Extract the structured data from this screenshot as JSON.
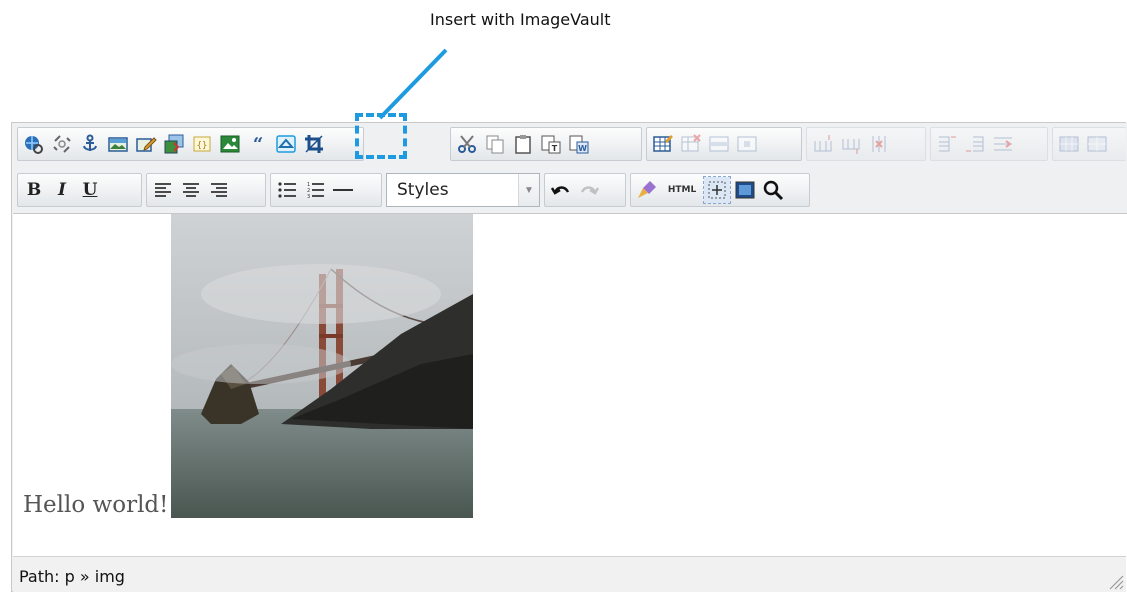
{
  "callout": {
    "text": "Insert with ImageVault",
    "color": "#1e9be0"
  },
  "toolbar": {
    "row1": [
      {
        "name": "insert-link-icon"
      },
      {
        "name": "unlink-icon"
      },
      {
        "name": "anchor-icon"
      },
      {
        "name": "image-icon"
      },
      {
        "name": "edit-image-icon"
      },
      {
        "name": "insert-media-icon"
      },
      {
        "name": "dynamic-content-icon"
      },
      {
        "name": "image-gallery-icon"
      },
      {
        "name": "blockquote-icon"
      },
      {
        "name": "imagevault-insert-icon"
      },
      {
        "name": "crop-icon"
      },
      {
        "name": "cut-icon"
      },
      {
        "name": "copy-icon"
      },
      {
        "name": "paste-icon"
      },
      {
        "name": "paste-text-icon"
      },
      {
        "name": "paste-word-icon"
      },
      {
        "name": "table-icon"
      },
      {
        "name": "delete-table-icon"
      },
      {
        "name": "row-props-icon"
      },
      {
        "name": "cell-props-icon"
      }
    ],
    "row2": {
      "bold": "B",
      "italic": "I",
      "underline": "U",
      "styles_label": "Styles",
      "html_label": "HTML"
    }
  },
  "content": {
    "text": "Hello world!"
  },
  "status": {
    "path": "Path: p » img"
  }
}
